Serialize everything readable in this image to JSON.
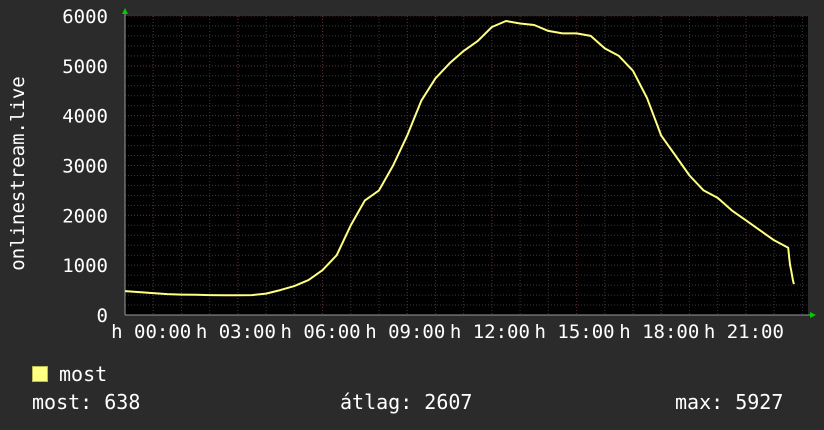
{
  "chart_data": {
    "type": "line",
    "ylabel": "onlinestream.live",
    "ylim": [
      0,
      6000
    ],
    "yticks": [
      0,
      1000,
      2000,
      3000,
      4000,
      5000,
      6000
    ],
    "xticks": [
      "h 00:00",
      "h 03:00",
      "h 06:00",
      "h 09:00",
      "h 12:00",
      "h 15:00",
      "h 18:00",
      "h 21:00"
    ],
    "grid": true,
    "series": [
      {
        "name": "most",
        "color": "#ffff80",
        "x_hours": [
          -1.0,
          -0.5,
          0.0,
          0.5,
          1.0,
          1.5,
          2.0,
          2.5,
          3.0,
          3.5,
          4.0,
          4.5,
          5.0,
          5.5,
          6.0,
          6.5,
          7.0,
          7.5,
          8.0,
          8.5,
          9.0,
          9.5,
          10.0,
          10.5,
          11.0,
          11.5,
          12.0,
          12.5,
          13.0,
          13.5,
          14.0,
          14.5,
          15.0,
          15.5,
          16.0,
          16.5,
          17.0,
          17.5,
          18.0,
          18.5,
          19.0,
          19.5,
          20.0,
          20.5,
          21.0,
          21.5,
          22.0,
          22.5
        ],
        "values": [
          480,
          460,
          440,
          420,
          410,
          405,
          400,
          395,
          395,
          400,
          430,
          500,
          580,
          700,
          900,
          1200,
          1800,
          2300,
          2500,
          3000,
          3600,
          4300,
          4750,
          5050,
          5300,
          5500,
          5780,
          5900,
          5850,
          5820,
          5700,
          5650,
          5650,
          5600,
          5350,
          5200,
          4900,
          4350,
          3600,
          3200,
          2800,
          2500,
          2350,
          2100,
          1900,
          1700,
          1500,
          1350,
          1150,
          1000,
          900,
          800,
          700,
          620
        ]
      }
    ]
  },
  "legend": {
    "label": "most"
  },
  "stats": {
    "current": "most: 638",
    "average": "átlag: 2607",
    "maximum": "max: 5927"
  },
  "colors": {
    "background": "#2b2b2b",
    "plot_background": "#000000",
    "grid_minor": "#3a3a3a",
    "grid_major": "#5a2a2a",
    "line": "#ffff80",
    "arrow": "#00cc00"
  }
}
